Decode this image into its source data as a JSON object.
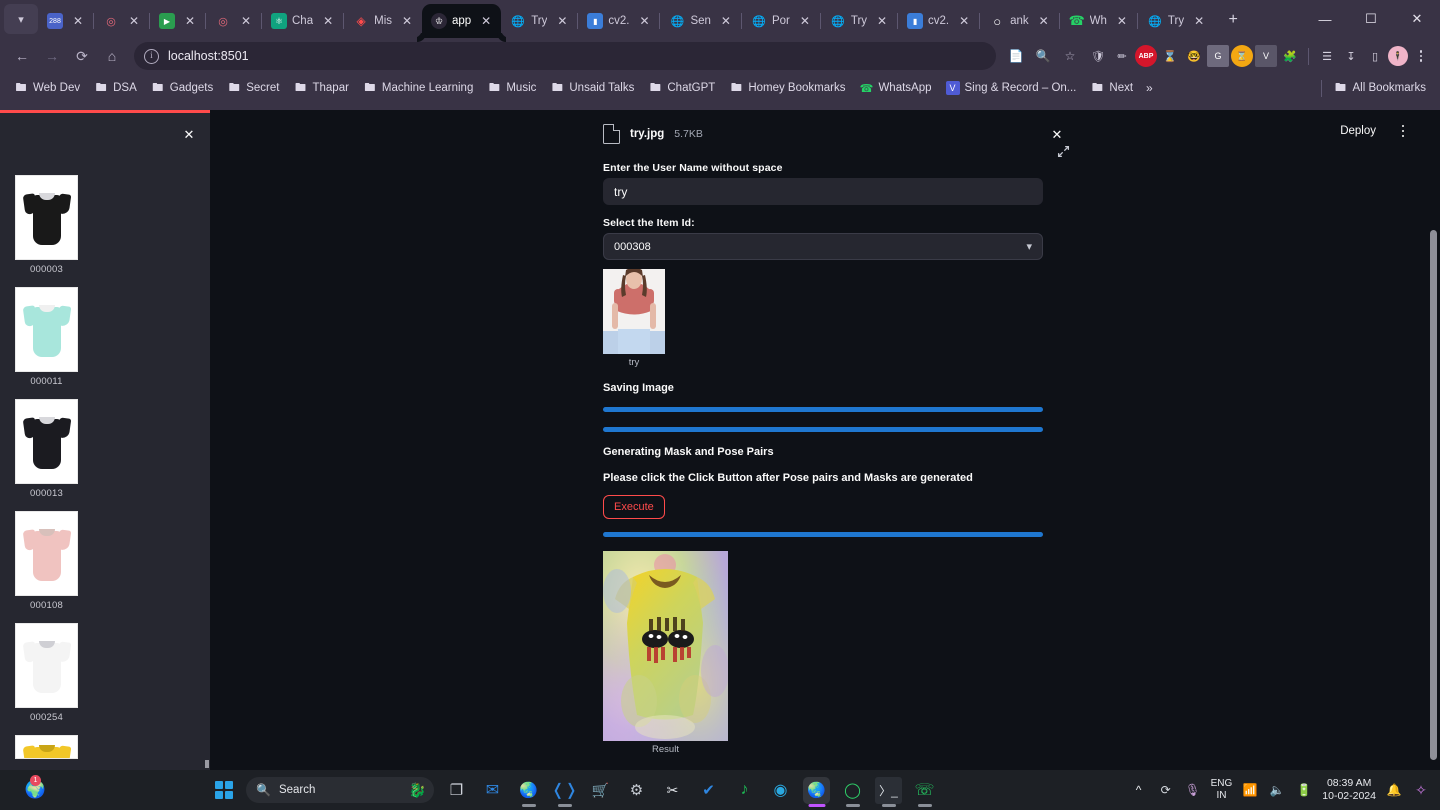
{
  "browser": {
    "tabs": [
      {
        "label": "",
        "icon": "mail-badge-icon",
        "short": true
      },
      {
        "label": "",
        "icon": "record-icon",
        "short": true
      },
      {
        "label": "",
        "icon": "meet-icon",
        "short": true
      },
      {
        "label": "",
        "icon": "record-icon",
        "short": true
      },
      {
        "label": "Cha",
        "icon": "chatgpt-icon"
      },
      {
        "label": "Mis",
        "icon": "flame-icon"
      },
      {
        "label": "app",
        "icon": "streamlit-icon",
        "active": true
      },
      {
        "label": "Try",
        "icon": "globe-icon"
      },
      {
        "label": "cv2.",
        "icon": "terminal-icon"
      },
      {
        "label": "Sen",
        "icon": "globe-icon"
      },
      {
        "label": "Por",
        "icon": "globe-icon"
      },
      {
        "label": "Try",
        "icon": "globe-icon"
      },
      {
        "label": "cv2.",
        "icon": "terminal-icon"
      },
      {
        "label": "ank",
        "icon": "github-icon"
      },
      {
        "label": "Wh",
        "icon": "whatsapp-icon"
      },
      {
        "label": "Try",
        "icon": "globe-icon"
      }
    ],
    "new_tab_label": "+",
    "window_controls": [
      "minimize",
      "restore",
      "close"
    ],
    "nav": {
      "back_icon": "back-arrow-icon",
      "forward_icon": "forward-arrow-icon",
      "reload_icon": "reload-icon",
      "home_icon": "home-icon",
      "url": "localhost:8501",
      "site_info_icon": "site-info-icon",
      "omnibox_actions": [
        "translate-icon",
        "zoom-out-icon",
        "bookmark-star-icon"
      ],
      "extensions": [
        "shield-icon",
        "pen-icon",
        "abp-icon",
        "hourglass-icon",
        "nerd-face-icon",
        "grammarly-icon",
        "clock-orange-icon",
        "v-icon",
        "puzzle-icon"
      ],
      "right_icons": [
        "reading-list-icon",
        "download-icon",
        "side-panel-icon"
      ],
      "profile_label": "profile-avatar",
      "menu_icon": "kebab-menu-icon"
    },
    "bookmarks": [
      {
        "label": "Web Dev",
        "icon": "folder-icon"
      },
      {
        "label": "DSA",
        "icon": "folder-icon"
      },
      {
        "label": "Gadgets",
        "icon": "folder-icon"
      },
      {
        "label": "Secret",
        "icon": "folder-icon"
      },
      {
        "label": "Thapar",
        "icon": "folder-icon"
      },
      {
        "label": "Machine Learning",
        "icon": "folder-icon"
      },
      {
        "label": "Music",
        "icon": "folder-icon"
      },
      {
        "label": "Unsaid Talks",
        "icon": "folder-icon"
      },
      {
        "label": "ChatGPT",
        "icon": "folder-icon"
      },
      {
        "label": "Homey Bookmarks",
        "icon": "folder-icon"
      },
      {
        "label": "WhatsApp",
        "icon": "whatsapp-icon"
      },
      {
        "label": "Sing & Record – On...",
        "icon": "v-icon"
      },
      {
        "label": "Next",
        "icon": "folder-icon"
      }
    ],
    "bookmarks_overflow_label": "»",
    "all_bookmarks_label": "All Bookmarks",
    "all_bookmarks_icon": "folder-icon"
  },
  "app": {
    "deploy_label": "Deploy",
    "menu_icon": "app-kebab-menu-icon",
    "sidebar": {
      "close_icon": "sidebar-close-icon",
      "items": [
        {
          "caption": "000003",
          "color": "#191919",
          "accent": "#111111"
        },
        {
          "caption": "000011",
          "color": "#a8e6dc",
          "accent": "#8fd8cc"
        },
        {
          "caption": "000013",
          "color": "#1b1b20",
          "accent": "#121216"
        },
        {
          "caption": "000108",
          "color": "#f0c3c0",
          "accent": "#e8b2ae"
        },
        {
          "caption": "000254",
          "color": "#f4f4f4",
          "accent": "#e4e4e4"
        },
        {
          "caption": "",
          "color": "#f2c728",
          "accent": "#e0b71a"
        }
      ]
    },
    "uploader": {
      "file_name": "try.jpg",
      "file_size": "5.7KB",
      "file_icon": "file-icon",
      "remove_icon": "remove-file-icon"
    },
    "username_field": {
      "label": "Enter the User Name without space",
      "value": "try",
      "placeholder": ""
    },
    "item_select": {
      "label": "Select the Item Id:",
      "value": "000308",
      "chevron_icon": "chevron-down-icon",
      "options": [
        "000308"
      ]
    },
    "preview": {
      "caption": "try",
      "expand_icon": "fullscreen-expand-icon"
    },
    "status": {
      "saving": "Saving Image",
      "generating": "Generating Mask and Pose Pairs",
      "instruction": "Please click the Click Button after Pose pairs and Masks are generated"
    },
    "progress": {
      "bar1": 100,
      "bar2": 100,
      "bar3": 100,
      "color": "#1f77d0"
    },
    "execute_button": {
      "label": "Execute",
      "color": "#ff4b4b"
    },
    "result": {
      "caption": "Result"
    }
  },
  "taskbar": {
    "start_icon": "windows-start-icon",
    "search_placeholder": "Search",
    "search_icon": "search-icon",
    "search_doodle_icon": "dragon-doodle-icon",
    "pinned": [
      {
        "icon": "task-view-icon",
        "running": false
      },
      {
        "icon": "mail-icon",
        "running": false
      },
      {
        "icon": "chrome-icon",
        "running": true
      },
      {
        "icon": "vscode-icon",
        "running": true
      },
      {
        "icon": "microsoft-store-icon",
        "running": false
      },
      {
        "icon": "settings-icon",
        "running": false
      },
      {
        "icon": "snipping-tool-icon",
        "running": false
      },
      {
        "icon": "todo-check-icon",
        "running": false
      },
      {
        "icon": "spotify-icon",
        "running": false
      },
      {
        "icon": "edge-icon",
        "running": false
      },
      {
        "icon": "chrome-active-icon",
        "running": true,
        "active": true
      },
      {
        "icon": "opera-gx-icon",
        "running": true
      },
      {
        "icon": "terminal-icon",
        "running": true
      },
      {
        "icon": "whatsapp-icon",
        "running": true
      }
    ],
    "tray": {
      "overflow_icon": "show-hidden-icons-icon",
      "sync_icon": "onedrive-sync-icon",
      "mic_icon": "microphone-icon",
      "language_primary": "ENG",
      "language_secondary": "IN",
      "wifi_icon": "wifi-icon",
      "volume_icon": "volume-icon",
      "battery_icon": "battery-icon",
      "time": "08:39 AM",
      "date": "10-02-2024",
      "notification_icon": "notifications-icon",
      "copilot_icon": "copilot-icon"
    },
    "left_badge_icon": "whatsapp-notification-icon"
  }
}
